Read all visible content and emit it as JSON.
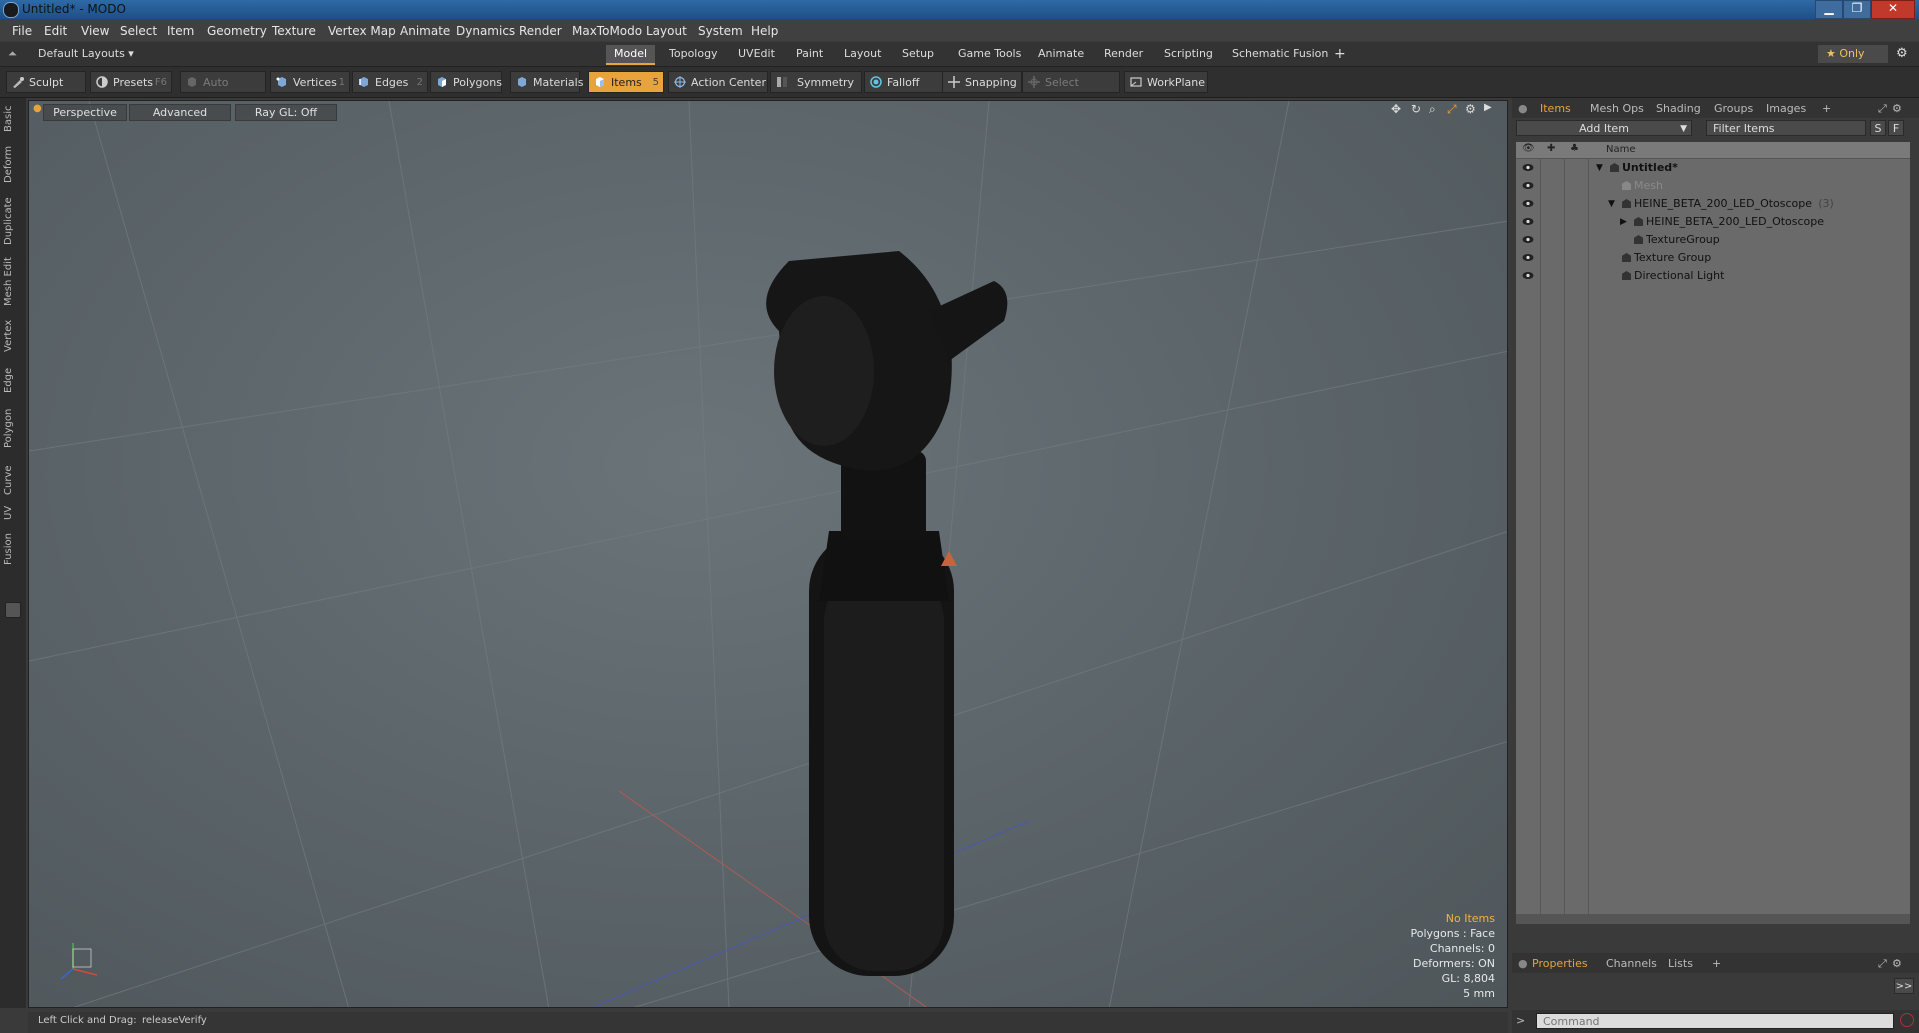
{
  "window": {
    "title": "Untitled* - MODO",
    "minimize": "▁",
    "restore": "❐",
    "close": "✕"
  },
  "menu": [
    "File",
    "Edit",
    "View",
    "Select",
    "Item",
    "Geometry",
    "Texture",
    "Vertex Map",
    "Animate",
    "Dynamics",
    "Render",
    "MaxToModo",
    "Layout",
    "System",
    "Help"
  ],
  "layouts": {
    "preset": "Default Layouts ▾",
    "tabs": [
      "Model",
      "Topology",
      "UVEdit",
      "Paint",
      "Layout",
      "Setup",
      "Game Tools",
      "Animate",
      "Render",
      "Scripting",
      "Schematic Fusion"
    ],
    "active_tab": "Model",
    "add": "+",
    "only": "★  Only",
    "settings": "⚙"
  },
  "toolbar": {
    "sculpt": "Sculpt",
    "presets": "Presets",
    "presets_key": "F6",
    "auto_select": "Auto Select",
    "vertices": "Vertices",
    "vertices_key": "1",
    "edges": "Edges",
    "edges_key": "2",
    "polygons": "Polygons",
    "materials": "Materials",
    "items": "Items",
    "items_key": "5",
    "action_center": "Action Center",
    "symmetry": "Symmetry",
    "falloff": "Falloff",
    "snapping": "Snapping",
    "select_through": "Select Through",
    "workplane": "WorkPlane"
  },
  "left_tabs": [
    "Basic",
    "Deform",
    "Duplicate",
    "Mesh Edit",
    "Vertex",
    "Edge",
    "Polygon",
    "Curve",
    "UV",
    "Fusion"
  ],
  "viewport": {
    "view": "Perspective",
    "shading": "Advanced",
    "raygl": "Ray GL: Off",
    "stats": {
      "selection": "No Items",
      "polygons": "Polygons : Face",
      "channels": "Channels: 0",
      "deformers": "Deformers: ON",
      "gl": "GL: 8,804",
      "unit": "5 mm"
    }
  },
  "items_panel": {
    "tabs": [
      "Items",
      "Mesh Ops",
      "Shading",
      "Groups",
      "Images"
    ],
    "active_tab": "Items",
    "add_tab": "+",
    "add_item": "Add Item",
    "filter": "Filter Items",
    "s_btn": "S",
    "f_btn": "F",
    "col_name": "Name",
    "rows": [
      {
        "label": "Untitled*",
        "indent": 0,
        "arrow": "▼",
        "bold": true,
        "dim": false,
        "count": ""
      },
      {
        "label": "Mesh",
        "indent": 1,
        "arrow": "",
        "bold": false,
        "dim": true,
        "count": ""
      },
      {
        "label": "HEINE_BETA_200_LED_Otoscope",
        "indent": 1,
        "arrow": "▼",
        "bold": false,
        "dim": false,
        "count": "(3)"
      },
      {
        "label": "HEINE_BETA_200_LED_Otoscope",
        "indent": 2,
        "arrow": "▶",
        "bold": false,
        "dim": false,
        "count": ""
      },
      {
        "label": "TextureGroup",
        "indent": 2,
        "arrow": "",
        "bold": false,
        "dim": false,
        "count": ""
      },
      {
        "label": "Texture Group",
        "indent": 1,
        "arrow": "",
        "bold": false,
        "dim": false,
        "count": ""
      },
      {
        "label": "Directional Light",
        "indent": 1,
        "arrow": "",
        "bold": false,
        "dim": false,
        "count": ""
      }
    ]
  },
  "properties_panel": {
    "tabs": [
      "Properties",
      "Channels",
      "Lists"
    ],
    "active_tab": "Properties",
    "add_tab": "+",
    "expand": ">>"
  },
  "status": {
    "hint_label": "Left Click and Drag:",
    "hint_value": "releaseVerify"
  },
  "command": {
    "placeholder": "Command"
  },
  "colors": {
    "accent": "#e8a33d",
    "viewport_bg": "#5a6368",
    "panel_bg": "#3a3a3a"
  }
}
